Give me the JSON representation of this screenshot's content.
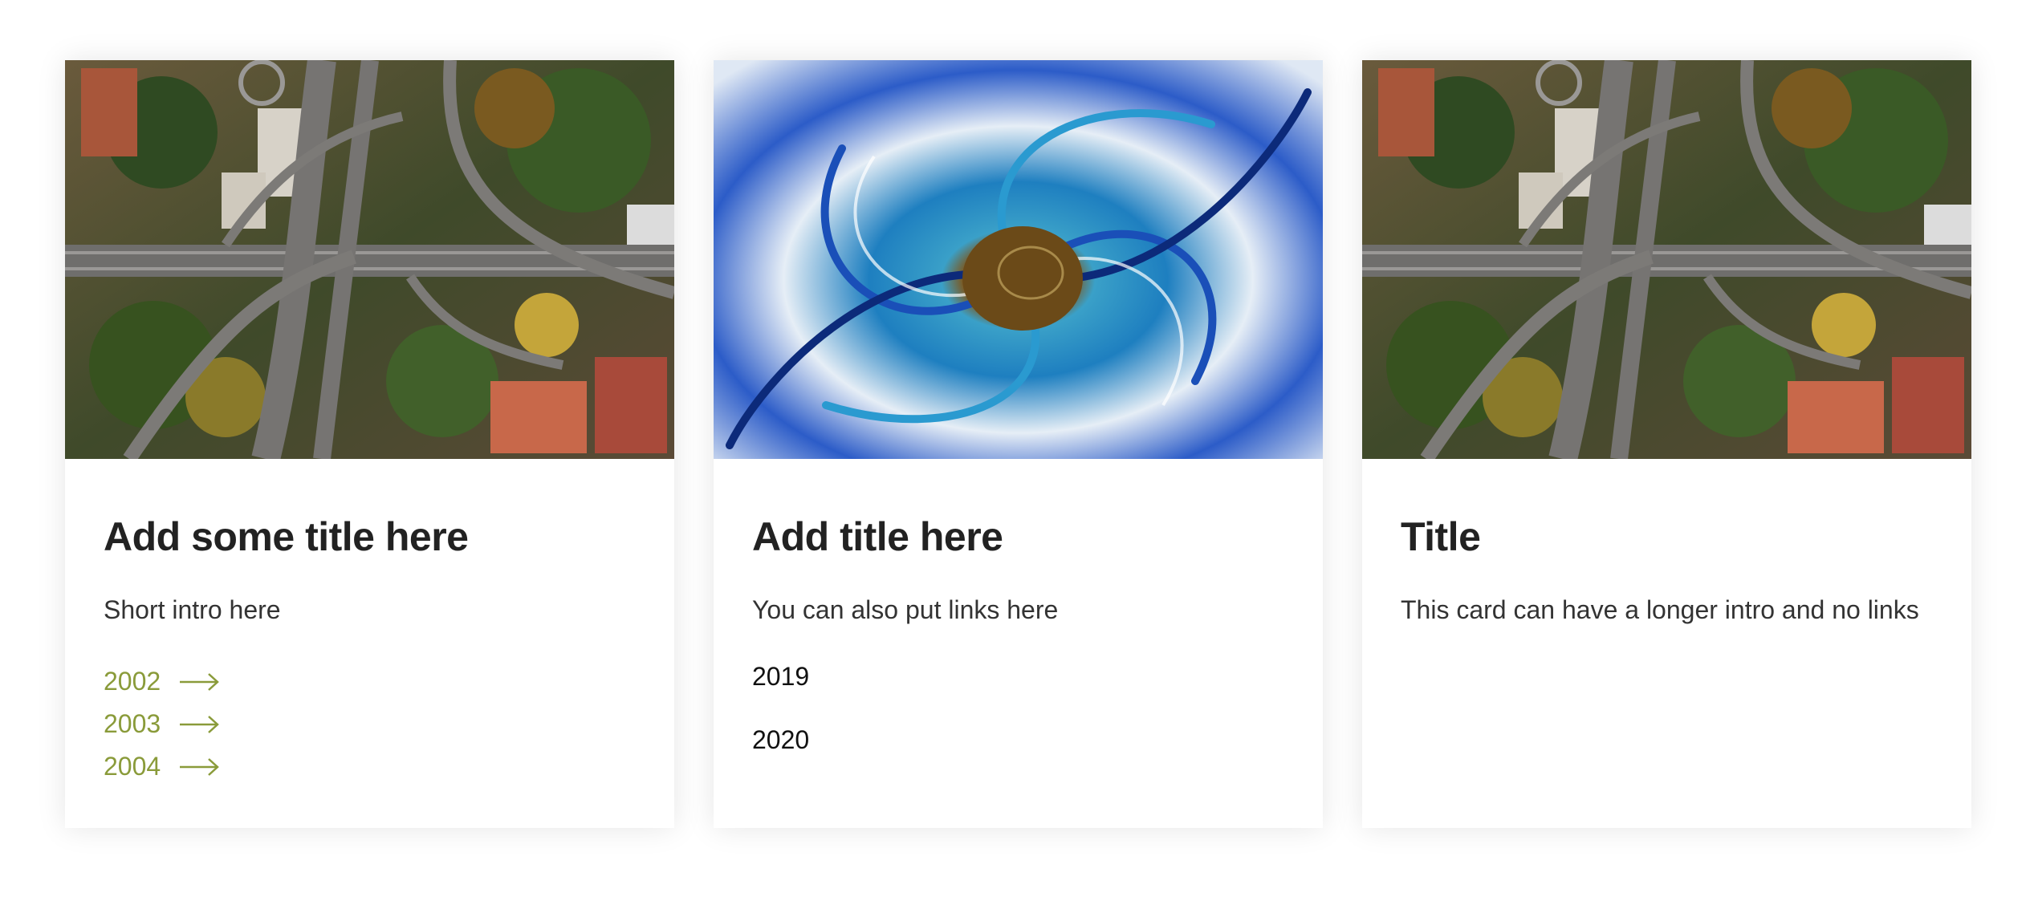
{
  "cards": [
    {
      "image": "aerial-highway-interchange",
      "title": "Add some title here",
      "intro": "Short intro here",
      "links": [
        "2002",
        "2003",
        "2004"
      ]
    },
    {
      "image": "blue-marbled-swirl",
      "title": "Add title here",
      "intro": "You can also put links here",
      "items": [
        "2019",
        "2020"
      ]
    },
    {
      "image": "aerial-highway-interchange",
      "title": "Title",
      "intro": "This card can have a longer intro and no links"
    }
  ],
  "colors": {
    "link": "#8a9b3a",
    "title": "#222222",
    "text": "#333333"
  },
  "icons": {
    "link_arrow": "arrow-right-icon"
  }
}
